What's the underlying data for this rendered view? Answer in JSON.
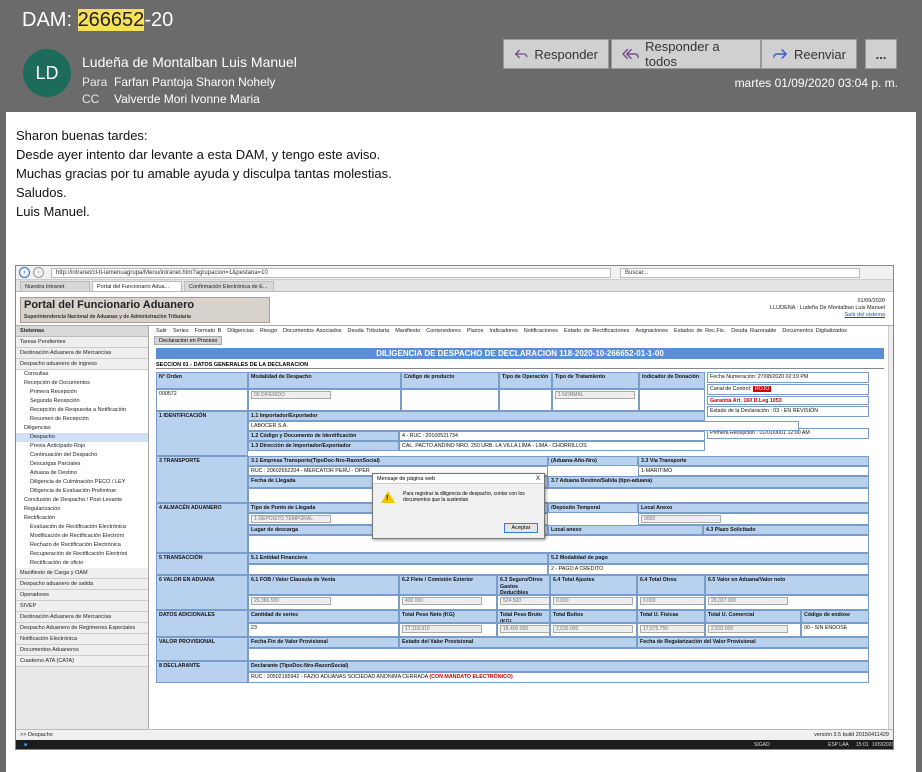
{
  "subject": {
    "prefix": "DAM: ",
    "highlight": "266652",
    "suffix": "-20"
  },
  "avatar": "LD",
  "sender": "Ludeña de Montalban Luis Manuel",
  "to": {
    "label": "Para",
    "value": "Farfan Pantoja Sharon Nohely"
  },
  "cc": {
    "label": "CC",
    "value": "Valverde Mori Ivonne Maria"
  },
  "actions": {
    "reply": "Responder",
    "reply_all": "Responder a todos",
    "forward": "Reenviar",
    "more": "..."
  },
  "date": "martes 01/09/2020 03:04 p. m.",
  "message": [
    "Sharon buenas tardes:",
    "Desde ayer intento dar levante a esta DAM, y tengo este aviso.",
    "",
    "Muchas gracias por tu amable ayuda y disculpa tantas molestias.",
    "",
    "Saludos.",
    "Luis Manuel."
  ],
  "browser": {
    "url": "http://intranet/cl-ti-iamenuagrupa/Menu/intranet.htm?agrupacion=1&pestana=10",
    "search": "Buscar...",
    "tabs": [
      "Nuestra Intranet",
      "Portal del Funcionario Adua...",
      "Confirmación Electrónica de E..."
    ]
  },
  "portal": {
    "title": "Portal del Funcionario Aduanero",
    "subtitle": "Superintendencia Nacional de Aduanas y de Administración Tributaria",
    "date": "01/09/2020",
    "user": "LLUDENA : Ludeña De Montalban Luis Manuel",
    "logout": "Salir del sistema"
  },
  "sidebar": [
    {
      "t": "h",
      "label": "Sistemas"
    },
    {
      "t": "g",
      "label": "Tareas Pendientes"
    },
    {
      "t": "g",
      "label": "Destinación Aduanera de Mercancías"
    },
    {
      "t": "g",
      "label": "Despacho aduanero de ingreso"
    },
    {
      "t": "i",
      "label": "Consultas",
      "lvl": 1
    },
    {
      "t": "i",
      "label": "Recepción de Documentos",
      "lvl": 1
    },
    {
      "t": "i",
      "label": "Primera Recepción",
      "lvl": 2
    },
    {
      "t": "i",
      "label": "Segunda Recepción",
      "lvl": 2
    },
    {
      "t": "i",
      "label": "Recepción de Respuesta a Notificación",
      "lvl": 2
    },
    {
      "t": "i",
      "label": "Resumen de Recepción",
      "lvl": 2
    },
    {
      "t": "i",
      "label": "Diligencias",
      "lvl": 1
    },
    {
      "t": "i",
      "label": "Despacho",
      "lvl": 2,
      "sel": true
    },
    {
      "t": "i",
      "label": "Previa Anticipado Rojo",
      "lvl": 2
    },
    {
      "t": "i",
      "label": "Continuación del Despacho",
      "lvl": 2
    },
    {
      "t": "i",
      "label": "Descargas Parciales",
      "lvl": 2
    },
    {
      "t": "i",
      "label": "Aduana de Destino",
      "lvl": 2
    },
    {
      "t": "i",
      "label": "Diligencia de Culminación PECO / LEY",
      "lvl": 2
    },
    {
      "t": "i",
      "label": "Diligencia de Evaluación Preliminar",
      "lvl": 2
    },
    {
      "t": "i",
      "label": "Conclusión de Despacho / Post-Levante",
      "lvl": 1
    },
    {
      "t": "i",
      "label": "Regularización",
      "lvl": 1
    },
    {
      "t": "i",
      "label": "Rectificación",
      "lvl": 1
    },
    {
      "t": "i",
      "label": "Evaluación de Rectificación Electrónica",
      "lvl": 2
    },
    {
      "t": "i",
      "label": "Modificación de Rectificación Electróni",
      "lvl": 2
    },
    {
      "t": "i",
      "label": "Rechazo de Rectificación Electrónica",
      "lvl": 2
    },
    {
      "t": "i",
      "label": "Recuperación de Rectificación Electróni",
      "lvl": 2
    },
    {
      "t": "i",
      "label": "Rectificación de oficio",
      "lvl": 2
    },
    {
      "t": "g",
      "label": "Manifiesto de Carga y OAM"
    },
    {
      "t": "g",
      "label": "Despacho aduanero de salida"
    },
    {
      "t": "g",
      "label": "Operadores"
    },
    {
      "t": "g",
      "label": "SIVEP"
    },
    {
      "t": "g",
      "label": "Destinación Aduanera de Mercancías"
    },
    {
      "t": "g",
      "label": "Despacho Aduanero de Regímenes Especiales"
    },
    {
      "t": "g",
      "label": "Notificación Electrónica"
    },
    {
      "t": "g",
      "label": "Documentos Aduaneros"
    },
    {
      "t": "g",
      "label": "Cuaderno ATA (CATA)"
    }
  ],
  "menu": [
    "Salir",
    "Series",
    "Formato B",
    "Diligencias",
    "Riesgo",
    "Documentos Asociados",
    "Deuda Tributaria",
    "Manifiesto",
    "Contenedores",
    "Plazos",
    "Indicadores",
    "Notificaciones",
    "Estado de Rectificaciones",
    "Asignaciones",
    "Estados de Rec.Fis.",
    "Deuda Razonable",
    "Documentos Digitalizados"
  ],
  "menu_tab": "Declaracion en Proceso",
  "doc_title": "DILIGENCIA DE DESPACHO DE DECLARACION 118-2020-10-266652-01-1-00",
  "section": "SECCION 01 - DATOS GENERALES DE LA DECLARACION",
  "cells": {
    "h_orden": "N° Orden",
    "h_mod": "Modalidad de Despacho",
    "h_cod": "Código de producto",
    "h_tipoop": "Tipo de Operación",
    "h_trat": "Tipo de Tratamiento",
    "h_don": "Indicador de Donación",
    "orden": "000572",
    "mod": "00 DIFERIDO",
    "trat": "1 NORMAL",
    "fnum": "Fecha Numeración: 27/08/2020 02:19 PM",
    "canal": "Canal de Control:",
    "canal_v": "ROJO",
    "garantia": "Garantía Art. 160 D.Leg 1053",
    "estado": "Estado de la Declaración : 03 - EN REVISIÓN",
    "prec": "Primera Recepción : 01/01/0001 12:00 AM",
    "s1": "1 IDENTIFICACIÓN",
    "s11": "1.1 Importador/Exportador",
    "s11v": "LABOCER S.A.",
    "s12": "1.2 Código y Documento de Identificación",
    "s12v": "4 - RUC : 20100521734",
    "s13": "1.3 Dirección de Importador/Exportador",
    "s13v": "CAL. PACTO ANDINO NRO. 250 URB. LA VILLA LIMA - LIMA - CHORRILLOS",
    "s3": "3 TRANSPORTE",
    "s31": "3.1 Empresa Transporte(TipoDoc-Nro-RazonSocial)",
    "s31v": "RUC : 20602652204 - MERCATOR PERU - OPER",
    "s32": "(Aduana-Año-Nro)",
    "s33": "3.3 Vía Transporte",
    "s33v": "1-MARITIMO",
    "sfl": "Fecha de Llegada",
    "s37": "3.7 Aduana Destino/Salida (tipo-aduana)",
    "s4": "4 ALMACÉN ADUANERO",
    "tpl": "Tipo de Punto de Llegada",
    "tplv": "1-DEPOSITO TEMPORAL",
    "ddt": "/Depósito Temporal",
    "lanex": "Local Anexo",
    "lanexv": "0000",
    "ldesc": "Lugar de descarga",
    "s42": "4.2 Depósito Aduanero",
    "lanexo": "Local anexo",
    "s43": "4.3 Plazo Solicitado",
    "s5": "5 TRANSACCIÓN",
    "s51": "5.1 Entidad Financiera",
    "s52": "5.2 Modalidad de pago",
    "s52v": "2 - PAGO A CREDITO",
    "s6": "6 VALOR EN ADUANA",
    "s61": "6.1 FOB / Valor Clausula de Venta",
    "s61v": "26,386.500",
    "s62": "6.2 Flete / Comisión Exterior",
    "s62v": "430.000",
    "s63": "6.3 Seguro/Otros Gastos Deducibles",
    "s63v": "524.500",
    "s64": "6.4 Total Ajustes",
    "s64v": "0.000",
    "s645": "6.4 Total Otros",
    "s645v": "0.000",
    "s65": "6.5 Valor en Aduana/Valor neto",
    "s65v": "26,027.000",
    "dad": "DATOS ADICIONALES",
    "cser": "Cantidad de series",
    "cserv": "23",
    "tpn": "Total Peso Neto (KG)",
    "tpnv": "17,118.910",
    "tpb": "Total Peso Bruto (KG)",
    "tpbv": "18,400.000",
    "tbul": "Total Bultos",
    "tbulv": "2,635.000",
    "tuf": "Total U. Físicas",
    "tufv": "17,575.750",
    "tuc": "Total U. Comercial",
    "tucv": "2,832.000",
    "cend": "Código de endose",
    "cendv": "00 - SIN ENDOSE",
    "vprov": "VALOR PROVISIONAL",
    "ffin": "Fecha Fin de Valor Provisional",
    "evp": "Estado del Valor Provisional",
    "freg": "Fecha de Regularización del Valor Provisional",
    "s8": "8 DECLARANTE",
    "decl": "Declarante (TipoDoc-Nro-RazonSocial)",
    "declv": "RUC : 20502165942 - FAZIO ADUANAS SOCIEDAD ANONIMA CERRADA",
    "mandato": "(CON MANDATO ELECTRÓNICO)"
  },
  "dialog": {
    "title": "Mensaje de página web",
    "close": "X",
    "message": "Para registrar la diligencia de despacho, contar con los documentos que la sustentan",
    "ok": "Aceptar"
  },
  "status": {
    "left": ">> Despacho",
    "right": "versión 3.5 build 20150411429"
  },
  "taskbar": {
    "sys": "SIGAD",
    "lang": "ESP LAA",
    "time": "15:01",
    "date": "1/09/2020"
  },
  "colors": {
    "header_bg": "#6b6b6b",
    "avatar": "#1d6b5a",
    "highlight": "#f6e05a",
    "title_bar": "#5b8ed6",
    "label_bg": "#b8d1ef",
    "alert": "#d40000"
  }
}
